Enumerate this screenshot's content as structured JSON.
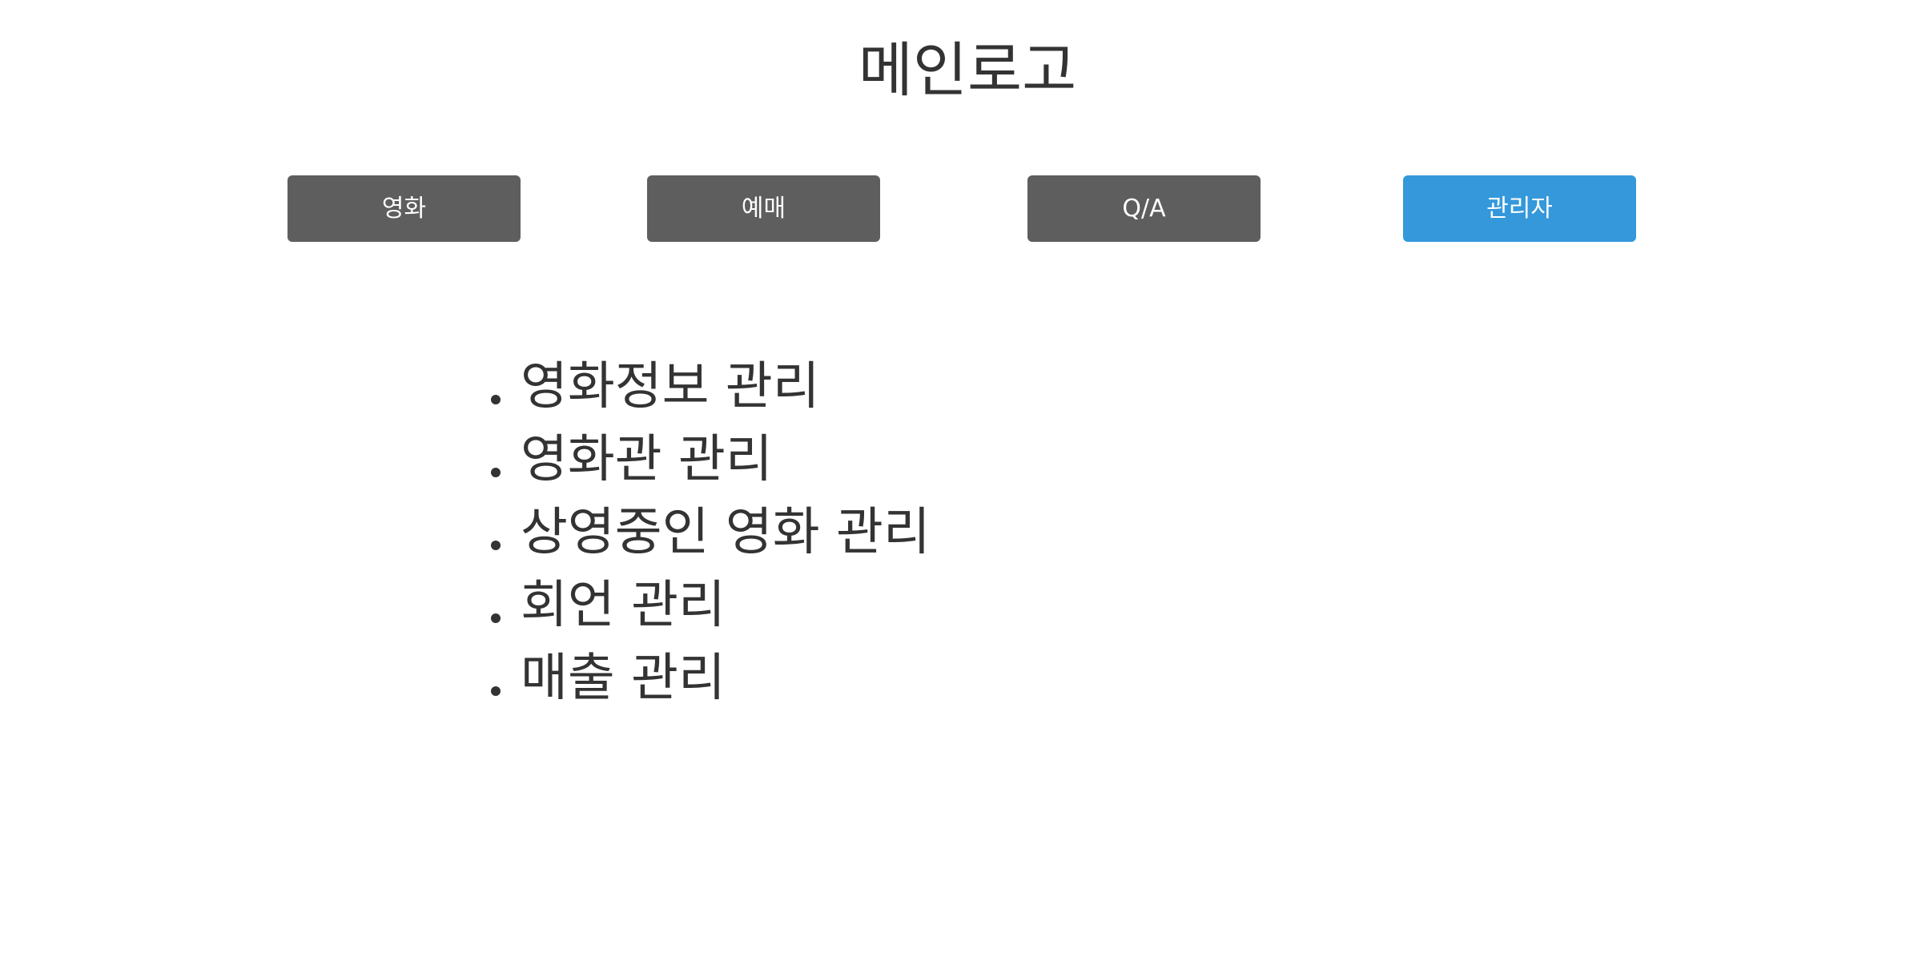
{
  "header": {
    "logo": "메인로고"
  },
  "nav": {
    "movie_label": "영화",
    "booking_label": "예매",
    "qa_label": "Q/A",
    "admin_label": "관리자",
    "active": "관리자",
    "colors": {
      "default": "#5e5e5e",
      "active": "#3498db",
      "text": "#ffffff"
    }
  },
  "admin_menu": {
    "items": [
      {
        "label": "영화정보 관리"
      },
      {
        "label": "영화관 관리"
      },
      {
        "label": "상영중인 영화 관리"
      },
      {
        "label": "회언 관리"
      },
      {
        "label": "매출 관리"
      }
    ]
  }
}
